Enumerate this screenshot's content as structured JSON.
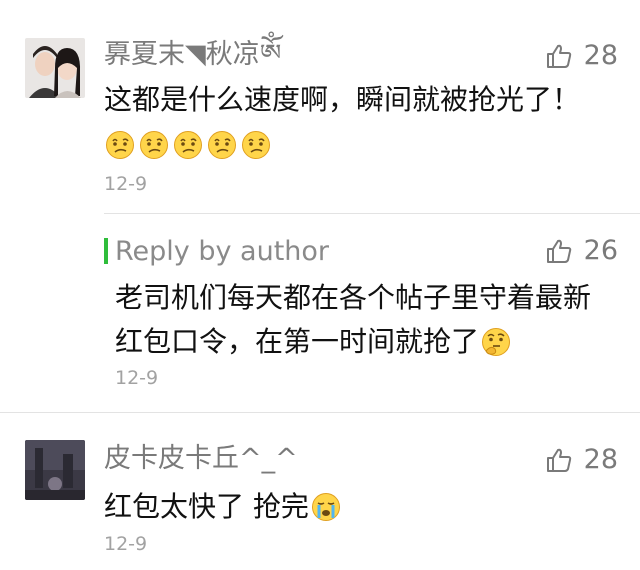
{
  "comments": [
    {
      "name": "奡夏末◥秋凉ༀ",
      "likes": "28",
      "text": "这都是什么速度啊，瞬间就被抢光了！",
      "emoji": [
        "confused-face",
        "confused-face",
        "confused-face",
        "confused-face",
        "confused-face"
      ],
      "date": "12-9",
      "reply": {
        "label": "Reply by author",
        "likes": "26",
        "line1": "老司机们每天都在各个帖子里守着最新",
        "line2": "红包口令，在第一时间就抢了",
        "emoji": "thinking-face",
        "date": "12-9"
      }
    },
    {
      "name": "皮卡皮卡丘^_^",
      "likes": "28",
      "text": "红包太快了 抢完",
      "emoji": "crying-face",
      "date": "12-9"
    }
  ],
  "colors": {
    "reply_accent": "#2fbd3b",
    "meta_text": "#7a7a7a",
    "date_text": "#a2a2a2"
  }
}
